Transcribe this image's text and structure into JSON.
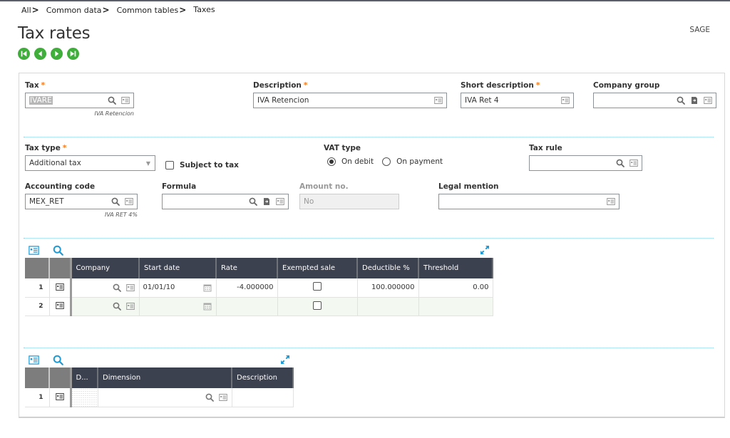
{
  "breadcrumb": [
    {
      "label": "All"
    },
    {
      "label": "Common data"
    },
    {
      "label": "Common tables"
    },
    {
      "label": "Taxes"
    }
  ],
  "page": {
    "title": "Tax rates",
    "company": "SAGE"
  },
  "nav_buttons": [
    {
      "name": "first-record-button",
      "icon": "skip-first-icon"
    },
    {
      "name": "previous-record-button",
      "icon": "previous-icon"
    },
    {
      "name": "next-record-button",
      "icon": "next-icon"
    },
    {
      "name": "last-record-button",
      "icon": "skip-last-icon"
    }
  ],
  "form": {
    "tax": {
      "label": "Tax",
      "required": "*",
      "value": "IVARE",
      "hint": "IVA Retencion"
    },
    "description": {
      "label": "Description",
      "required": "*",
      "value": "IVA Retencion"
    },
    "short_description": {
      "label": "Short description",
      "required": "*",
      "value": "IVA Ret 4"
    },
    "company_group": {
      "label": "Company group",
      "value": ""
    },
    "tax_type": {
      "label": "Tax type",
      "required": "*",
      "value": "Additional tax"
    },
    "subject_to_tax": {
      "label": "Subject to tax",
      "checked": false
    },
    "vat_type": {
      "label": "VAT type",
      "options": [
        "On debit",
        "On payment"
      ],
      "selected": "On debit"
    },
    "tax_rule": {
      "label": "Tax rule",
      "value": ""
    },
    "accounting_code": {
      "label": "Accounting code",
      "value": "MEX_RET",
      "hint": "IVA RET 4%"
    },
    "formula": {
      "label": "Formula",
      "value": ""
    },
    "amount_no": {
      "label": "Amount no.",
      "value": "No"
    },
    "legal_mention": {
      "label": "Legal mention",
      "value": ""
    }
  },
  "rates_table": {
    "columns": [
      "Company",
      "Start date",
      "Rate",
      "Exempted sale",
      "Deductible %",
      "Threshold"
    ],
    "rows": [
      {
        "num": "1",
        "company": "",
        "start_date": "01/01/10",
        "rate": "-4.000000",
        "exempted_sale": false,
        "deductible": "100.000000",
        "threshold": "0.00"
      },
      {
        "num": "2",
        "company": "",
        "start_date": "",
        "rate": "",
        "exempted_sale": false,
        "deductible": "",
        "threshold": ""
      }
    ]
  },
  "dimension_table": {
    "columns": [
      "D...",
      "Dimension",
      "Description"
    ],
    "rows": [
      {
        "num": "1",
        "d": "",
        "dimension": "",
        "description": ""
      }
    ]
  },
  "colors": {
    "accent": "#1e9bd7",
    "nav_green": "#3fae3a",
    "required": "#f07d2a",
    "header_dark": "#3c4150"
  }
}
